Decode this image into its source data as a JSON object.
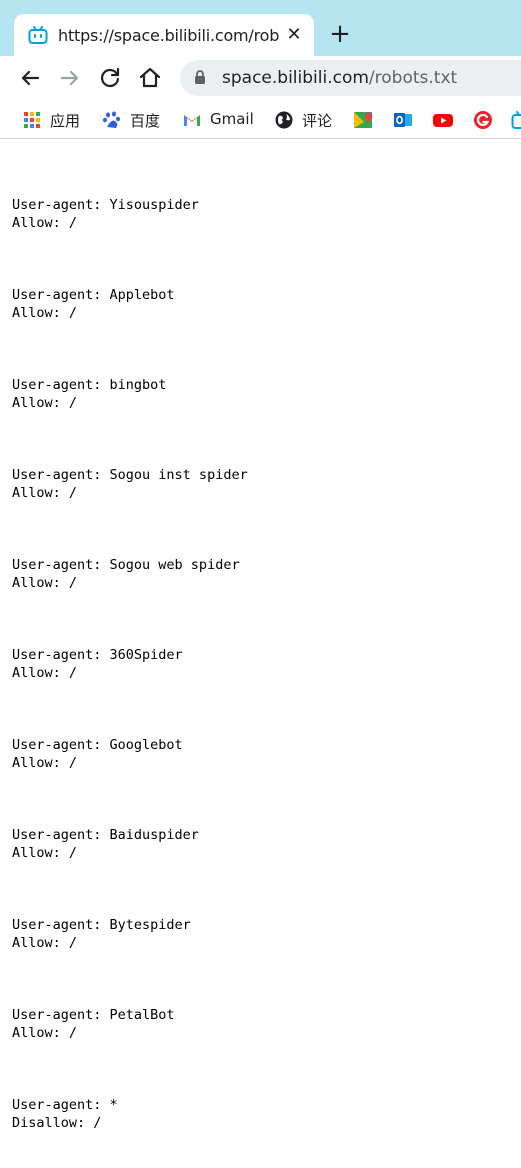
{
  "browser": {
    "tab_title": "https://space.bilibili.com/robots.txt",
    "tab_close": "✕",
    "new_tab": "+",
    "url_host": "space.bilibili.com",
    "url_path": "/robots.txt",
    "favicon_icon": "bilibili-tv-icon",
    "back_icon": "arrow-left-icon",
    "forward_icon": "arrow-right-icon",
    "reload_icon": "reload-icon",
    "home_icon": "home-icon",
    "lock_icon": "lock-icon",
    "accent_color": "#00a1d6",
    "tabstrip_color": "#b4e4f0"
  },
  "bookmarks": [
    {
      "label": "应用",
      "icon": "apps-grid-icon"
    },
    {
      "label": "百度",
      "icon": "baidu-paw-icon"
    },
    {
      "label": "Gmail",
      "icon": "gmail-icon"
    },
    {
      "label": "评论",
      "icon": "globe-icon"
    },
    {
      "label": "",
      "icon": "google-maps-icon"
    },
    {
      "label": "",
      "icon": "outlook-icon"
    },
    {
      "label": "",
      "icon": "youtube-icon"
    },
    {
      "label": "",
      "icon": "red-g-icon"
    },
    {
      "label": "",
      "icon": "bilibili-tv-icon"
    }
  ],
  "robots": [
    {
      "agent": "User-agent: Yisouspider",
      "rule": "Allow: /"
    },
    {
      "agent": "User-agent: Applebot",
      "rule": "Allow: /"
    },
    {
      "agent": "User-agent: bingbot",
      "rule": "Allow: /"
    },
    {
      "agent": "User-agent: Sogou inst spider",
      "rule": "Allow: /"
    },
    {
      "agent": "User-agent: Sogou web spider",
      "rule": "Allow: /"
    },
    {
      "agent": "User-agent: 360Spider",
      "rule": "Allow: /"
    },
    {
      "agent": "User-agent: Googlebot",
      "rule": "Allow: /"
    },
    {
      "agent": "User-agent: Baiduspider",
      "rule": "Allow: /"
    },
    {
      "agent": "User-agent: Bytespider",
      "rule": "Allow: /"
    },
    {
      "agent": "User-agent: PetalBot",
      "rule": "Allow: /"
    },
    {
      "agent": "User-agent: *",
      "rule": "Disallow: /"
    }
  ]
}
